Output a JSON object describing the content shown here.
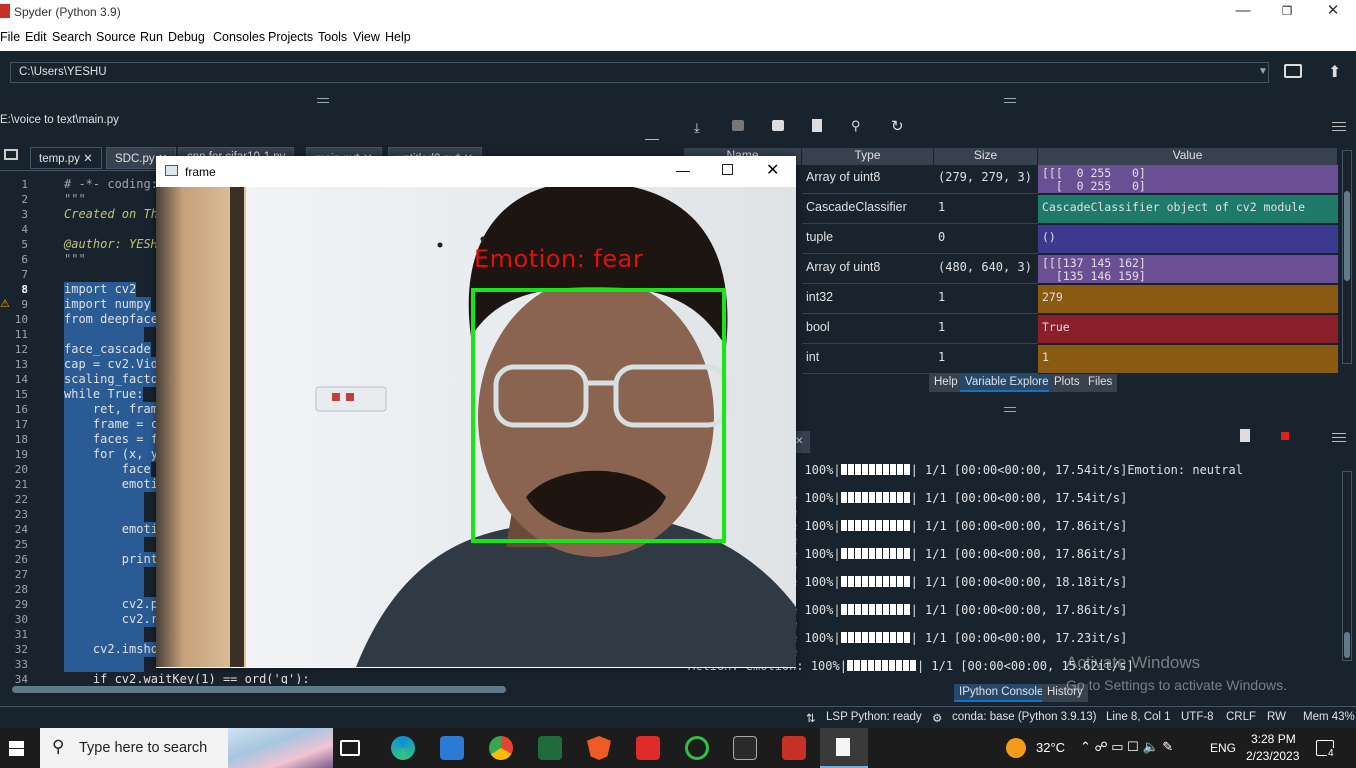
{
  "window": {
    "title": "Spyder (Python 3.9)"
  },
  "menu": [
    "File",
    "Edit",
    "Search",
    "Source",
    "Run",
    "Debug",
    "Consoles",
    "Projects",
    "Tools",
    "View",
    "Help"
  ],
  "path": {
    "current": "C:\\Users\\YESHU"
  },
  "editor": {
    "file_path": "E:\\voice to text\\main.py",
    "tabs": [
      "temp.py",
      "SDC.py",
      "cnn for cifar10-1.py",
      "main.py*",
      "untitled0.py*"
    ],
    "lines": [
      {
        "n": "1",
        "text": "# -*- coding:"
      },
      {
        "n": "2",
        "text": "\"\"\""
      },
      {
        "n": "3",
        "text": "Created on Th"
      },
      {
        "n": "4",
        "text": ""
      },
      {
        "n": "5",
        "text": "@author: YESH"
      },
      {
        "n": "6",
        "text": "\"\"\""
      },
      {
        "n": "7",
        "text": ""
      },
      {
        "n": "8",
        "text": "import cv2"
      },
      {
        "n": "9",
        "text": "import numpy"
      },
      {
        "n": "10",
        "text": "from deepface"
      },
      {
        "n": "11",
        "text": ""
      },
      {
        "n": "12",
        "text": "face_cascade"
      },
      {
        "n": "13",
        "text": "cap = cv2.Vid"
      },
      {
        "n": "14",
        "text": "scaling_facto"
      },
      {
        "n": "15",
        "text": "while True:"
      },
      {
        "n": "16",
        "text": "    ret, fram"
      },
      {
        "n": "17",
        "text": "    frame = c"
      },
      {
        "n": "18",
        "text": "    faces = f"
      },
      {
        "n": "19",
        "text": "    for (x, y"
      },
      {
        "n": "20",
        "text": "        face"
      },
      {
        "n": "21",
        "text": "        emoti"
      },
      {
        "n": "22",
        "text": ""
      },
      {
        "n": "23",
        "text": ""
      },
      {
        "n": "24",
        "text": "        emoti"
      },
      {
        "n": "25",
        "text": ""
      },
      {
        "n": "26",
        "text": "        print"
      },
      {
        "n": "27",
        "text": ""
      },
      {
        "n": "28",
        "text": ""
      },
      {
        "n": "29",
        "text": "        cv2.p"
      },
      {
        "n": "30",
        "text": "        cv2.r"
      },
      {
        "n": "31",
        "text": ""
      },
      {
        "n": "32",
        "text": "    cv2.imsho"
      },
      {
        "n": "33",
        "text": ""
      },
      {
        "n": "34",
        "text": "    if cv2.waitKey(1) == ord('q'):"
      }
    ]
  },
  "frame_window": {
    "title": "frame",
    "emotion_label": "Emotion: fear"
  },
  "variable_explorer": {
    "columns": [
      "Name",
      "Type",
      "Size",
      "Value"
    ],
    "rows": [
      {
        "type": "Array of uint8",
        "size": "(279, 279, 3)",
        "value": "[[[  0 255   0]\n  [  0 255   0]",
        "color": "#6a4f94"
      },
      {
        "type": "CascadeClassifier",
        "size": "1",
        "value": "CascadeClassifier object of cv2 module",
        "color": "#1f7a6a"
      },
      {
        "type": "tuple",
        "size": "0",
        "value": "()",
        "color": "#3b3a8f"
      },
      {
        "type": "Array of uint8",
        "size": "(480, 640, 3)",
        "value": "[[[137 145 162]\n  [135 146 159]",
        "color": "#6a4f94"
      },
      {
        "type": "int32",
        "size": "1",
        "value": "279",
        "color": "#8a5a12"
      },
      {
        "type": "bool",
        "size": "1",
        "value": "True",
        "color": "#8a1f2a"
      },
      {
        "type": "int",
        "size": "1",
        "value": "1",
        "color": "#8a5a12"
      }
    ],
    "pane_tabs": [
      "Help",
      "Variable Explorer",
      "Plots",
      "Files"
    ]
  },
  "console": {
    "lines": [
      ": 100%|",
      "e 100%|",
      "e",
      "e 100%|",
      "e",
      "e 100%|",
      "e",
      "e 100%|",
      "l",
      "e 100%|",
      "e",
      "e 100%|",
      "e"
    ],
    "progress": [
      {
        "rate": "1/1 [00:00<00:00, 17.54it/s]Emotion: neutral"
      },
      {
        "rate": "1/1 [00:00<00:00, 17.54it/s]"
      },
      {
        "rate": "1/1 [00:00<00:00, 17.86it/s]"
      },
      {
        "rate": "1/1 [00:00<00:00, 17.86it/s]"
      },
      {
        "rate": "1/1 [00:00<00:00, 18.18it/s]"
      },
      {
        "rate": "1/1 [00:00<00:00, 17.86it/s]"
      },
      {
        "rate": "1/1 [00:00<00:00, 17.23it/s]"
      },
      {
        "rate": "1/1 [00:00<00:00, 15.62it/s]"
      }
    ],
    "last_prefix": "Action: emotion: 100%|",
    "tabs": [
      "IPython Console",
      "History"
    ]
  },
  "watermark": {
    "line1": "Activate Windows",
    "line2": "Go to Settings to activate Windows."
  },
  "statusbar": {
    "lsp": "LSP Python: ready",
    "env": "conda: base (Python 3.9.13)",
    "position": "Line 8, Col 1",
    "encoding": "UTF-8",
    "eol": "CRLF",
    "rw": "RW",
    "mem": "Mem 43%"
  },
  "taskbar": {
    "search_placeholder": "Type here to search",
    "weather": "32°C",
    "lang": "ENG",
    "time": "3:28 PM",
    "date": "2/23/2023",
    "notifications": "4"
  }
}
